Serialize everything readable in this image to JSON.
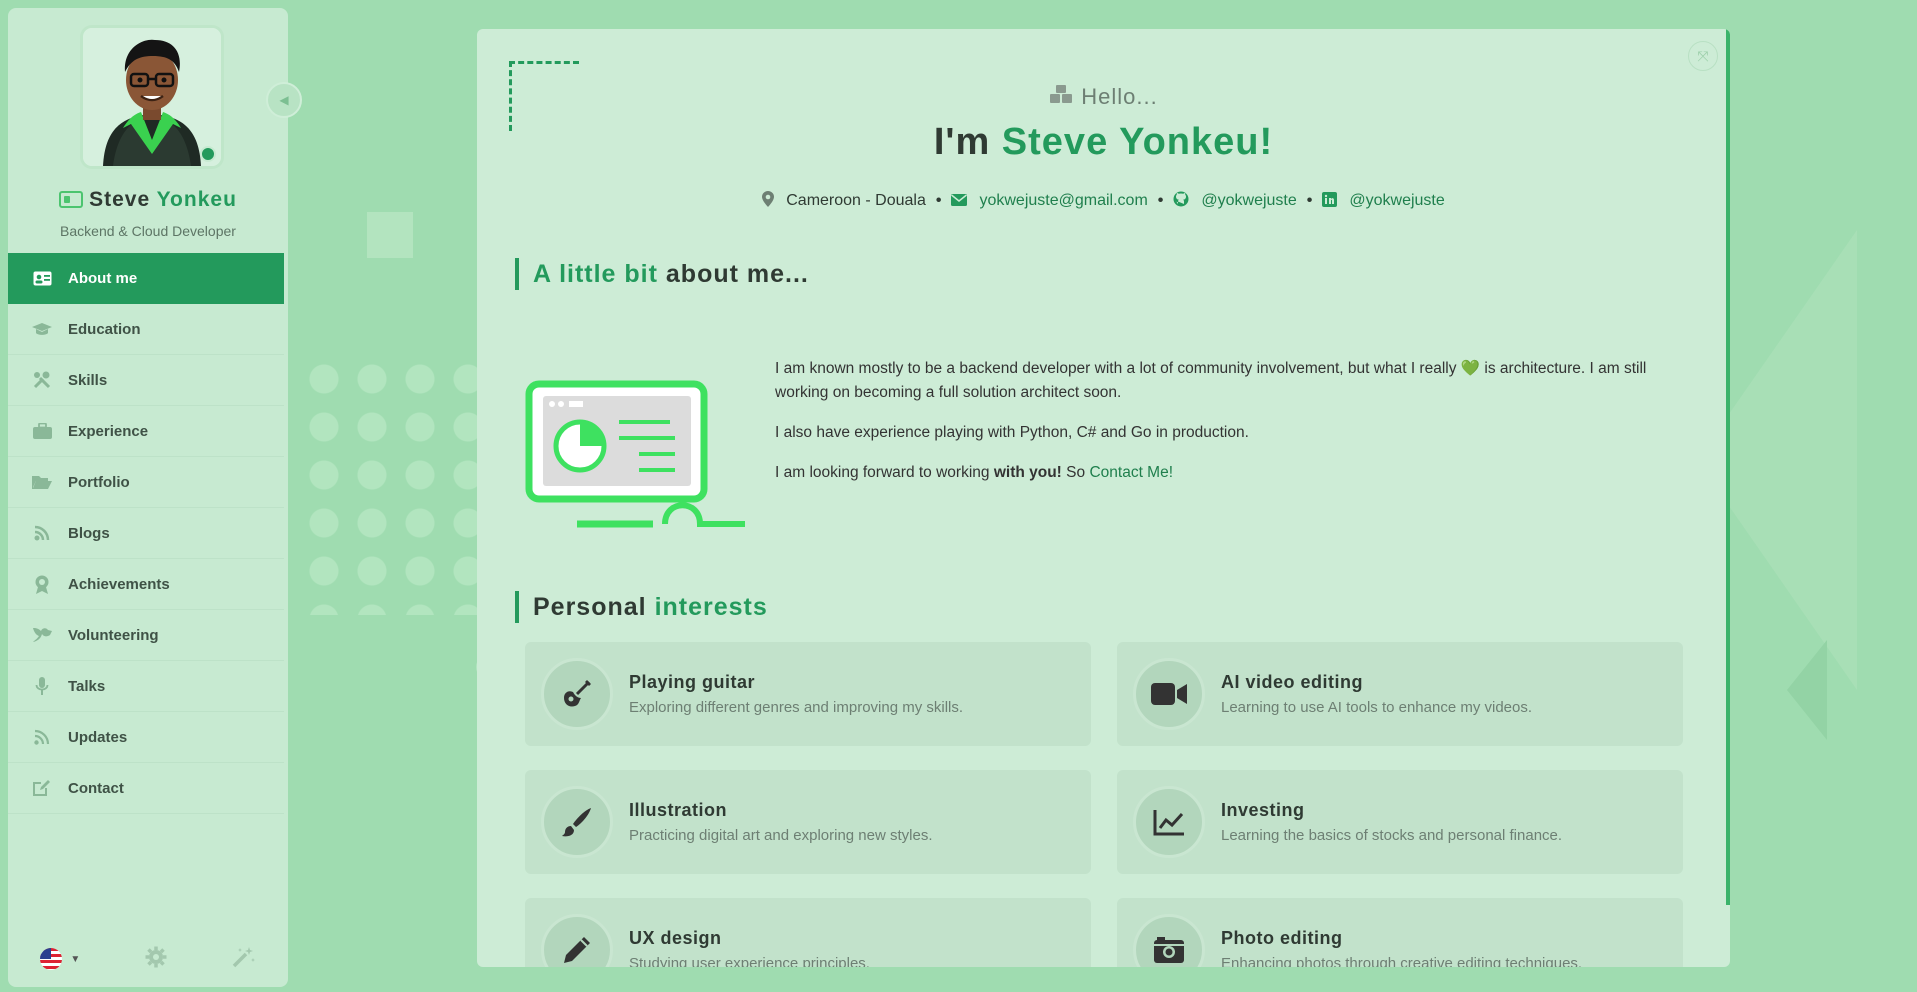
{
  "profile": {
    "first_name": "Steve",
    "last_name": "Yonkeu",
    "subtitle": "Backend & Cloud Developer"
  },
  "nav": {
    "items": [
      {
        "label": "About me",
        "icon": "id-card-icon",
        "active": true
      },
      {
        "label": "Education",
        "icon": "graduation-cap-icon"
      },
      {
        "label": "Skills",
        "icon": "tools-icon"
      },
      {
        "label": "Experience",
        "icon": "briefcase-icon"
      },
      {
        "label": "Portfolio",
        "icon": "folder-open-icon"
      },
      {
        "label": "Blogs",
        "icon": "blog-icon"
      },
      {
        "label": "Achievements",
        "icon": "award-icon"
      },
      {
        "label": "Volunteering",
        "icon": "dove-icon"
      },
      {
        "label": "Talks",
        "icon": "microphone-icon"
      },
      {
        "label": "Updates",
        "icon": "rss-icon"
      },
      {
        "label": "Contact",
        "icon": "edit-icon"
      }
    ]
  },
  "header": {
    "hello": "Hello...",
    "im_prefix": "I'm",
    "name": "Steve Yonkeu!"
  },
  "contacts": {
    "location": "Cameroon - Douala",
    "email": "yokwejuste@gmail.com",
    "github": "@yokwejuste",
    "linkedin": "@yokwejuste"
  },
  "about": {
    "title_accent": "A little bit",
    "title_rest": "about me...",
    "p1_a": "I am known mostly to be a backend developer with a lot of community involvement, but what I really",
    "p1_b": "is architecture. I am still working on becoming a full solution architect soon.",
    "p2": "I also have experience playing with Python, C# and Go in production.",
    "p3_a": "I am looking forward to working",
    "p3_bold": "with you!",
    "p3_b": "So",
    "p3_link": "Contact Me!"
  },
  "interests": {
    "title_plain": "Personal",
    "title_accent": "interests",
    "items": [
      {
        "title": "Playing guitar",
        "desc": "Exploring different genres and improving my skills.",
        "icon": "guitar-icon"
      },
      {
        "title": "AI video editing",
        "desc": "Learning to use AI tools to enhance my videos.",
        "icon": "video-camera-icon"
      },
      {
        "title": "Illustration",
        "desc": "Practicing digital art and exploring new styles.",
        "icon": "paintbrush-icon"
      },
      {
        "title": "Investing",
        "desc": "Learning the basics of stocks and personal finance.",
        "icon": "chart-line-icon"
      },
      {
        "title": "UX design",
        "desc": "Studying user experience principles.",
        "icon": "pencil-icon"
      },
      {
        "title": "Photo editing",
        "desc": "Enhancing photos through creative editing techniques.",
        "icon": "camera-retro-icon"
      }
    ]
  },
  "colors": {
    "accent": "#239a5c",
    "background": "#9fdcb0"
  }
}
